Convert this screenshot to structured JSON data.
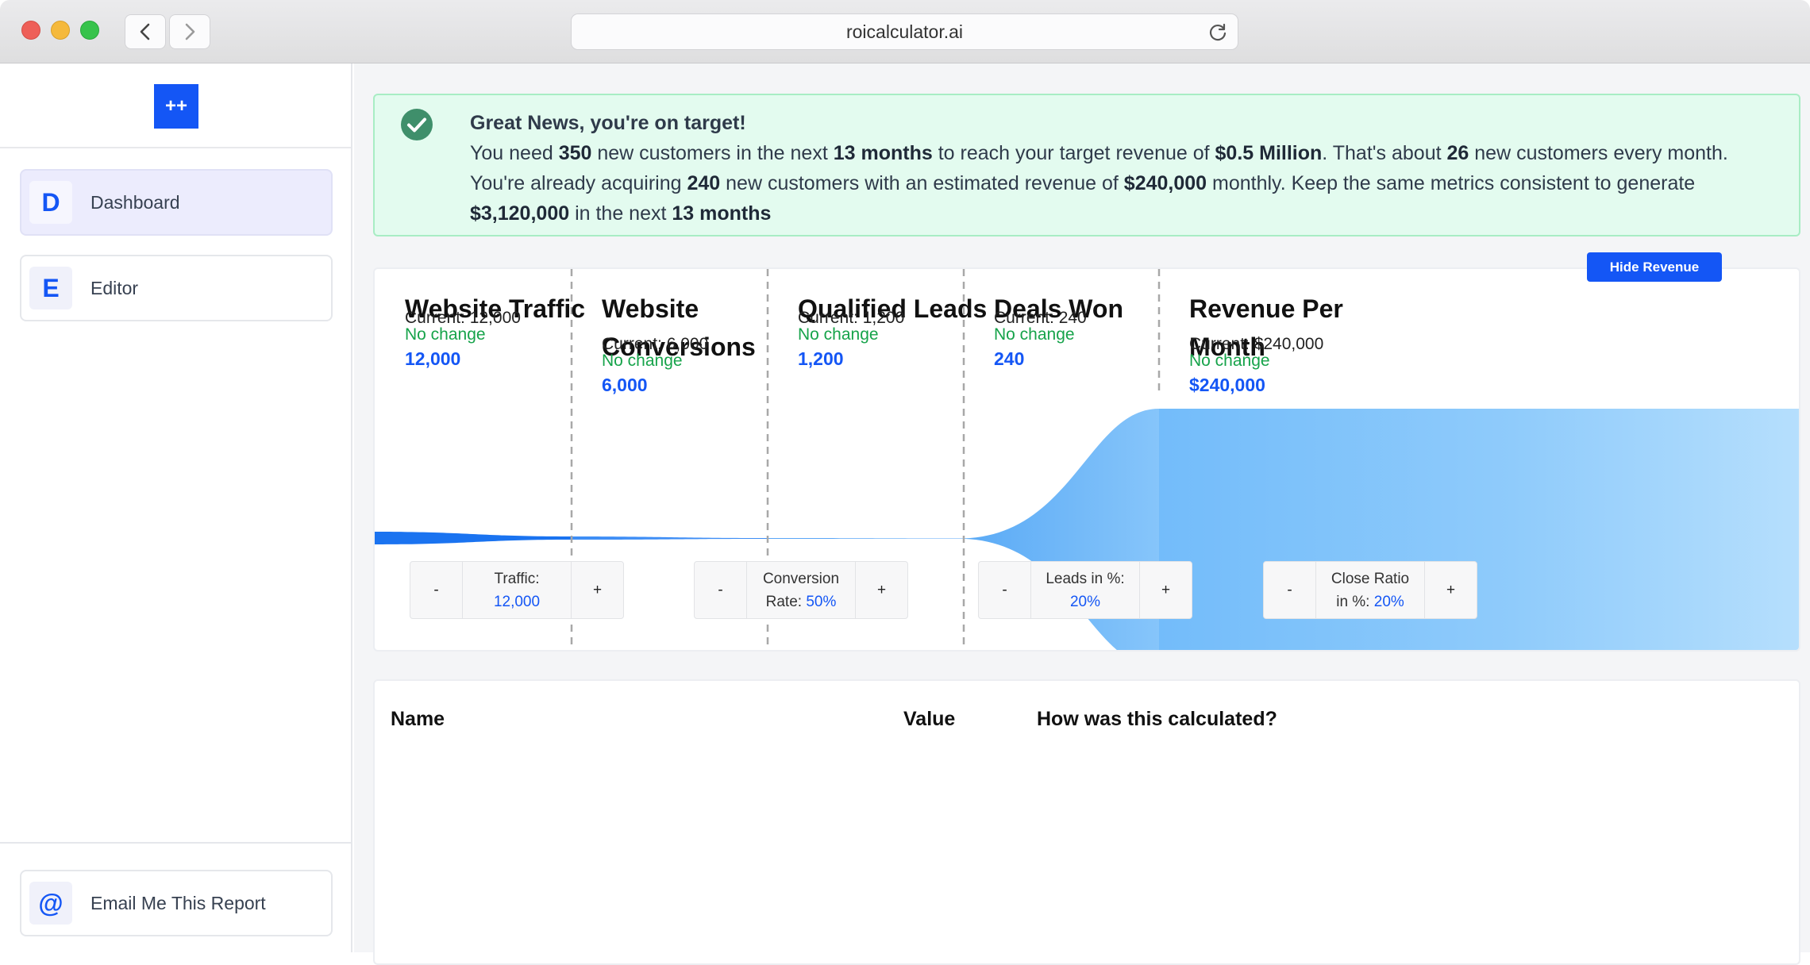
{
  "browser": {
    "url": "roicalculator.ai"
  },
  "sidebar": {
    "logo_text": "++",
    "items": [
      {
        "letter": "D",
        "label": "Dashboard",
        "active": true
      },
      {
        "letter": "E",
        "label": "Editor",
        "active": false
      }
    ],
    "bottom_item": {
      "letter": "@",
      "label": "Email Me This Report"
    }
  },
  "alert": {
    "title": "Great News, you're on target!",
    "l1a": "You need ",
    "l1b": "350",
    "l1c": " new customers in the next ",
    "l1d": "13 months",
    "l1e": " to reach your target revenue of ",
    "l1f": "$0.5 Million",
    "l1g": ". That's about ",
    "l1h": "26",
    "l1i": " new customers every month.",
    "l2a": "You're already acquiring ",
    "l2b": "240",
    "l2c": " new customers with an estimated revenue of ",
    "l2d": "$240,000",
    "l2e": " monthly. Keep the same metrics consistent to generate",
    "l3a": "$3,120,000",
    "l3b": " in the next ",
    "l3c": "13 months"
  },
  "hide_revenue_label": "Hide Revenue",
  "stages": [
    {
      "title": "Website Traffic",
      "current": "Current: 12,000",
      "change": "No change",
      "value": "12,000"
    },
    {
      "title": "Website Conversions",
      "current": "Current: 6,000",
      "change": "No change",
      "value": "6,000"
    },
    {
      "title": "Qualified Leads",
      "current": "Current: 1,200",
      "change": "No change",
      "value": "1,200"
    },
    {
      "title": "Deals Won",
      "current": "Current: 240",
      "change": "No change",
      "value": "240"
    },
    {
      "title": "Revenue Per Month",
      "current": "Current: $240,000",
      "change": "No change",
      "value": "$240,000"
    }
  ],
  "controls": [
    {
      "minus": "-",
      "plus": "+",
      "label": "Traffic:",
      "value": "12,000"
    },
    {
      "minus": "-",
      "plus": "+",
      "label": "Conversion",
      "label2": "Rate: ",
      "value": "50%"
    },
    {
      "minus": "-",
      "plus": "+",
      "label": "Leads in %:",
      "value": "20%"
    },
    {
      "minus": "-",
      "plus": "+",
      "label": "Close Ratio",
      "label2": "in %: ",
      "value": "20%"
    }
  ],
  "table": {
    "headers": [
      "Name",
      "Value",
      "How was this calculated?"
    ]
  },
  "colors": {
    "accent": "#1456f5",
    "positive": "#16a34a",
    "alert_bg": "#e3fbef",
    "funnel_dark": "#1a73f0",
    "funnel_light": "#8fcbfb"
  }
}
